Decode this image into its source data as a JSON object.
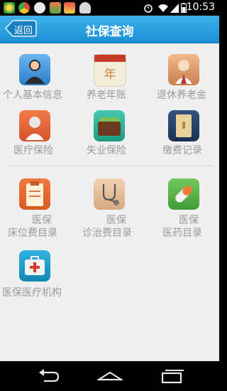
{
  "status_bar": {
    "time": "10:53",
    "icons": [
      "app-icon",
      "chrome-icon",
      "weather-icon",
      "app-icon",
      "app-icon",
      "android-icon",
      "alarm-icon",
      "wifi-icon",
      "signal-icon",
      "battery-icon"
    ]
  },
  "header": {
    "back_label": "返回",
    "title": "社保查询"
  },
  "grid": [
    {
      "label": "个人基本信息",
      "icon": "person-icon",
      "color": "#3a8fd8"
    },
    {
      "label": "养老年账",
      "icon": "calendar-icon",
      "color": "#f2ead8"
    },
    {
      "label": "退休养老金",
      "icon": "elder-icon",
      "color": "#d99a6c"
    },
    {
      "label": "医疗保险",
      "icon": "doctor-icon",
      "color": "#e8663a"
    },
    {
      "label": "失业保险",
      "icon": "wallet-icon",
      "color": "#2fb39b"
    },
    {
      "label": "缴费记录",
      "icon": "ledger-icon",
      "color": "#253f66"
    },
    {
      "label_line1": "医保",
      "label_line2": "床位费目录",
      "icon": "clipboard-icon",
      "color": "#e9682d"
    },
    {
      "label_line1": "医保",
      "label_line2": "诊治费目录",
      "icon": "stethoscope-icon",
      "color": "#e6c3a3"
    },
    {
      "label_line1": "医保",
      "label_line2": "医药目录",
      "icon": "pill-icon",
      "color": "#5cb54a"
    },
    {
      "label": "医保医疗机构",
      "icon": "first-aid-kit-icon",
      "color": "#1e9cc8"
    }
  ],
  "nav": [
    "back-icon",
    "home-icon",
    "recent-apps-icon"
  ]
}
